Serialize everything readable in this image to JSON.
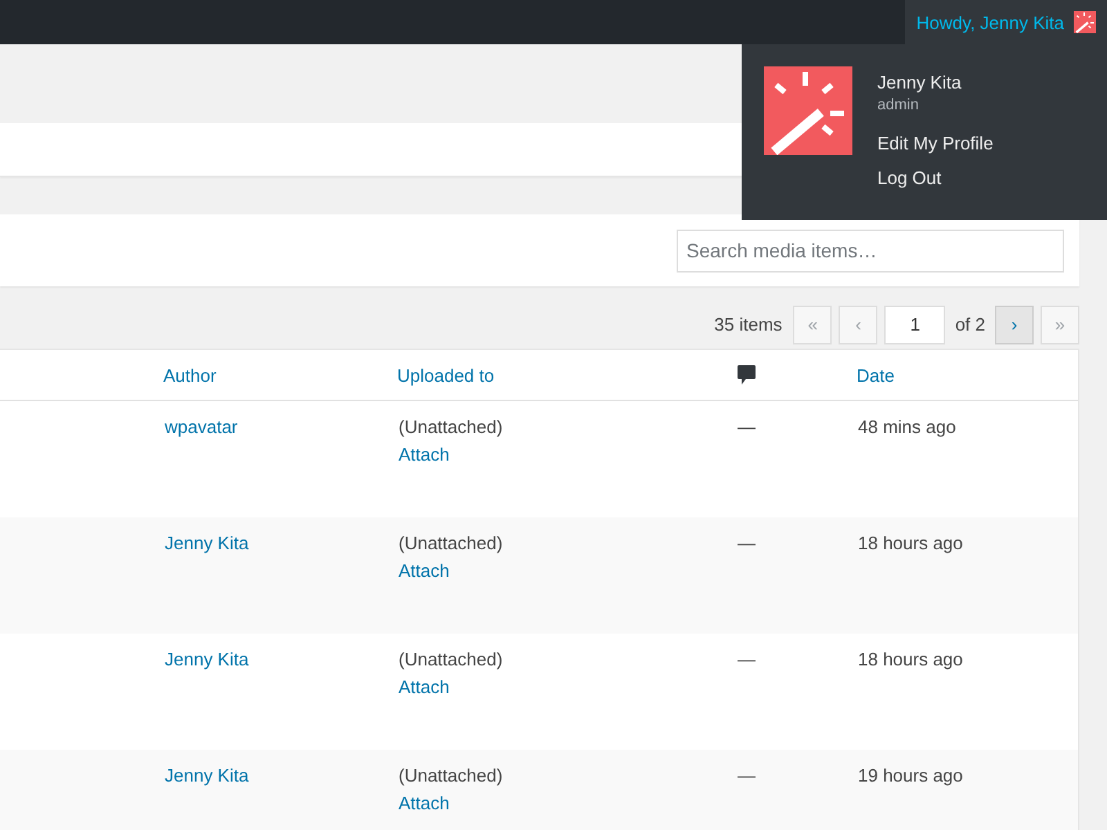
{
  "admin_bar": {
    "greeting": "Howdy, Jenny Kita"
  },
  "user_menu": {
    "name": "Jenny Kita",
    "role": "admin",
    "links": [
      "Edit My Profile",
      "Log Out"
    ]
  },
  "search": {
    "placeholder": "Search media items…"
  },
  "pagination": {
    "count": "35 items",
    "before": [
      {
        "label": "«",
        "disabled": true
      },
      {
        "label": "‹",
        "disabled": true
      }
    ],
    "page": "1",
    "of": "of 2",
    "after": [
      {
        "label": "›",
        "disabled": false
      },
      {
        "label": "»",
        "disabled": true
      }
    ]
  },
  "table": {
    "columns": [
      {
        "kind": "text",
        "label": "Author"
      },
      {
        "kind": "text",
        "label": "Uploaded to"
      },
      {
        "kind": "comments"
      },
      {
        "kind": "text",
        "label": "Date"
      }
    ],
    "rows": [
      {
        "author": "wpavatar",
        "uploaded_to": "(Unattached)",
        "action": "Attach",
        "comments": "—",
        "date": "48 mins ago"
      },
      {
        "author": "Jenny Kita",
        "uploaded_to": "(Unattached)",
        "action": "Attach",
        "comments": "—",
        "date": "18 hours ago"
      },
      {
        "author": "Jenny Kita",
        "uploaded_to": "(Unattached)",
        "action": "Attach",
        "comments": "—",
        "date": "18 hours ago"
      },
      {
        "author": "Jenny Kita",
        "uploaded_to": "(Unattached)",
        "action": "Attach",
        "comments": "—",
        "date": "19 hours ago"
      }
    ]
  }
}
